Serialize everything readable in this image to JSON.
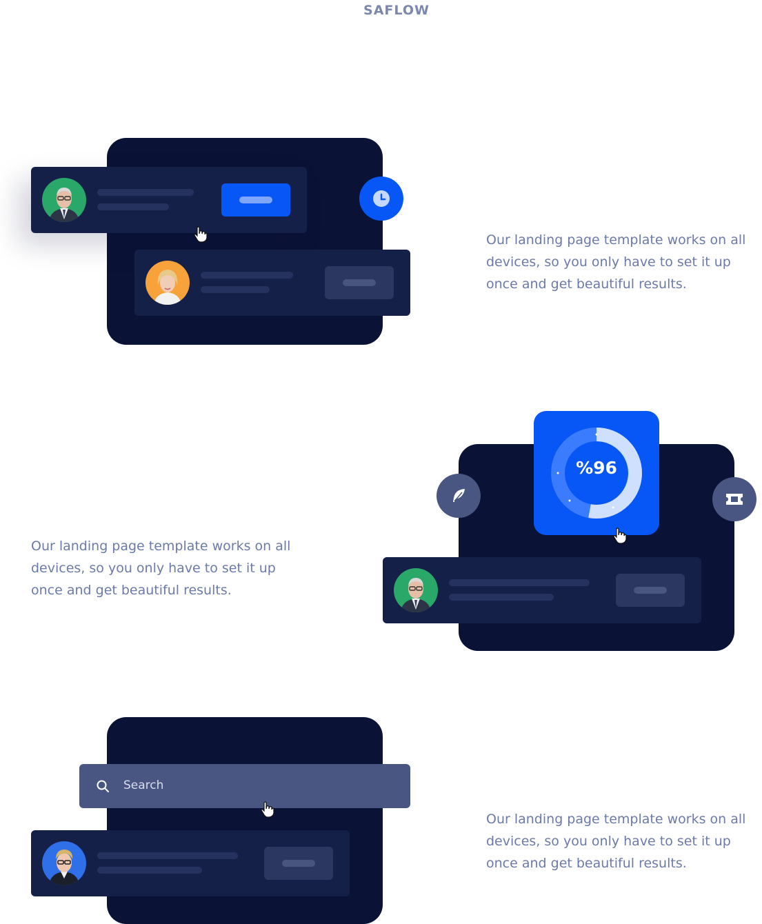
{
  "brand": "SAFLOW",
  "section1": {
    "description": "Our landing page template works on all devices, so you only have to set it up once and get beautiful results.",
    "icons": {
      "clock": "clock-icon",
      "cursor": "pointer-hand-icon"
    },
    "colors": {
      "panel": "#0a1235",
      "accent": "#0756f6"
    }
  },
  "section2": {
    "description": "Our landing page template works on all devices, so you only have to set it up once and get beautiful results.",
    "progress_label": "%96",
    "progress_value": 96,
    "icons": {
      "left": "feather-icon",
      "right": "ticket-icon"
    }
  },
  "section3": {
    "description": "Our landing page template works on all devices, so you only have to set it up once and get beautiful results.",
    "search": {
      "placeholder": "Search"
    },
    "icons": {
      "search": "search-icon"
    }
  }
}
